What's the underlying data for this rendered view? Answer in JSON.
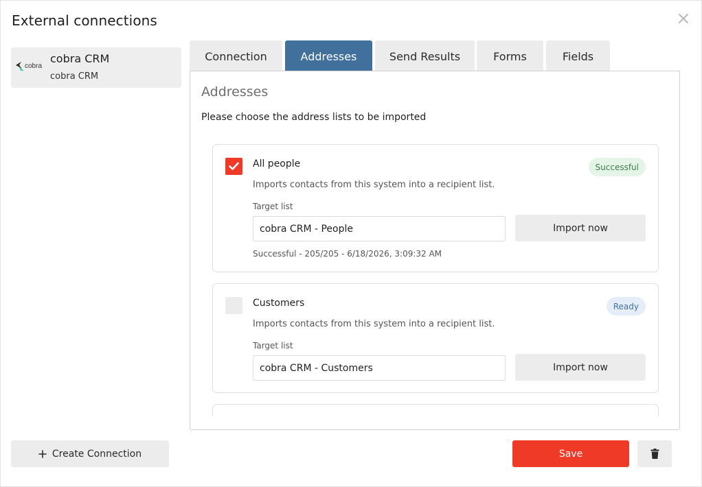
{
  "dialog": {
    "title": "External connections"
  },
  "icons": {
    "close": "close-icon",
    "check": "check-icon",
    "plus": "plus-icon",
    "trash": "trash-icon",
    "logo": "cobra-logo-icon"
  },
  "colors": {
    "accent": "#ee3a27",
    "tab_active": "#41709d",
    "success_bg": "#e4f5e8",
    "success_text": "#3e7b4e",
    "ready_bg": "#e4edf8",
    "ready_text": "#46709d"
  },
  "sidebar": {
    "connections": [
      {
        "logo_text": "cobra",
        "name": "cobra CRM",
        "subtitle": "cobra CRM"
      }
    ],
    "create_label": "Create Connection"
  },
  "tabs": [
    {
      "label": "Connection",
      "active": false
    },
    {
      "label": "Addresses",
      "active": true
    },
    {
      "label": "Send Results",
      "active": false
    },
    {
      "label": "Forms",
      "active": false
    },
    {
      "label": "Fields",
      "active": false
    }
  ],
  "panel": {
    "title": "Addresses",
    "description": "Please choose the address lists to be imported",
    "lists": [
      {
        "name": "All people",
        "checked": true,
        "status": "Successful",
        "description": "Imports contacts from this system into a recipient list.",
        "target_label": "Target list",
        "target_value": "cobra CRM - People",
        "import_label": "Import now",
        "status_line": "Successful - 205/205 - 6/18/2026, 3:09:32 AM"
      },
      {
        "name": "Customers",
        "checked": false,
        "status": "Ready",
        "description": "Imports contacts from this system into a recipient list.",
        "target_label": "Target list",
        "target_value": "cobra CRM - Customers",
        "import_label": "Import now"
      }
    ]
  },
  "footer": {
    "save_label": "Save"
  }
}
